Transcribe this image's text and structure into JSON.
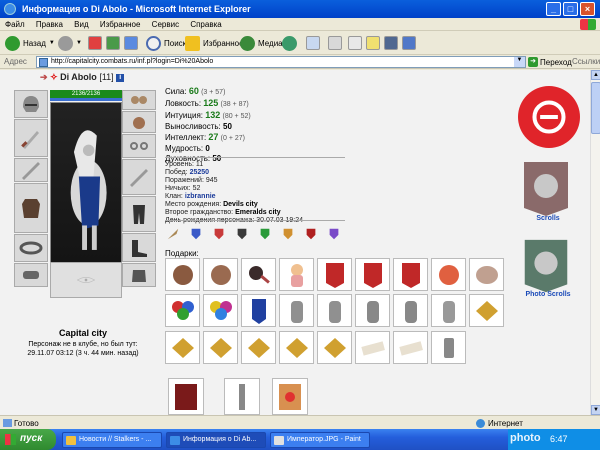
{
  "window": {
    "title": "Информация о Di Abolo - Microsoft Internet Explorer"
  },
  "menu": [
    "Файл",
    "Правка",
    "Вид",
    "Избранное",
    "Сервис",
    "Справка"
  ],
  "toolbar": {
    "back": "Назад",
    "search": "Поиск",
    "favorites": "Избранное",
    "media": "Медиа"
  },
  "address": {
    "label": "Адрес",
    "url": "http://capitalcity.combats.ru/inf.pl?login=Di%20Abolo",
    "go": "Переход",
    "links": "Ссылки"
  },
  "character": {
    "name": "Di Abolo",
    "level": "[11]",
    "info_badge": "i",
    "hp": "2136/2136",
    "hp_fraction": 1.0,
    "city": "Capital city",
    "status_line1": "Персонаж не в клубе, но был тут:",
    "status_line2": "29.11.07 03:12 (3 ч. 44 мин. назад)"
  },
  "stats": [
    {
      "label": "Сила:",
      "value": "60",
      "bonus": "(3 + 57)"
    },
    {
      "label": "Ловкость:",
      "value": "125",
      "bonus": "(38 + 87)"
    },
    {
      "label": "Интуиция:",
      "value": "132",
      "bonus": "(80 + 52)"
    },
    {
      "label": "Выносливость:",
      "value": "50",
      "bonus": ""
    },
    {
      "label": "Интеллект:",
      "value": "27",
      "bonus": "(0 + 27)"
    },
    {
      "label": "Мудрость:",
      "value": "0",
      "bonus": ""
    },
    {
      "label": "Духовность:",
      "value": "50",
      "bonus": ""
    }
  ],
  "info": {
    "level": {
      "label": "Уровень:",
      "value": "11"
    },
    "wins": {
      "label": "Побед:",
      "value": "25250"
    },
    "losses": {
      "label": "Поражений:",
      "value": "945"
    },
    "draws": {
      "label": "Ничьих:",
      "value": "52"
    },
    "clan": {
      "label": "Клан:",
      "value": "izbrannie"
    },
    "birthplace": {
      "label": "Место рождения:",
      "value": "Devils city"
    },
    "citizenship": {
      "label": "Второе гражданство:",
      "value": "Emeralds city"
    },
    "birthday": {
      "label": "День рождения персонажа:",
      "value": "30.07.03 19:24"
    }
  },
  "gifts_label": "Подарки:",
  "right_panel": {
    "scrolls": "Scrolls",
    "photo_scrolls": "Photo Scrolls"
  },
  "status_bar": {
    "left": "Готово",
    "right": "Интернет"
  },
  "taskbar": {
    "start": "пуск",
    "tasks": [
      "Новости // Stalkers - ...",
      "Информация о Di Ab...",
      "Император.JPG - Paint"
    ],
    "clock": "6:47",
    "watermark": "photo"
  },
  "colors": {
    "stat_value": "#1a7a1a",
    "hp_bar": "#1a8a1a",
    "link_blue": "#1a4ab8",
    "logo_red": "#e0242a"
  }
}
